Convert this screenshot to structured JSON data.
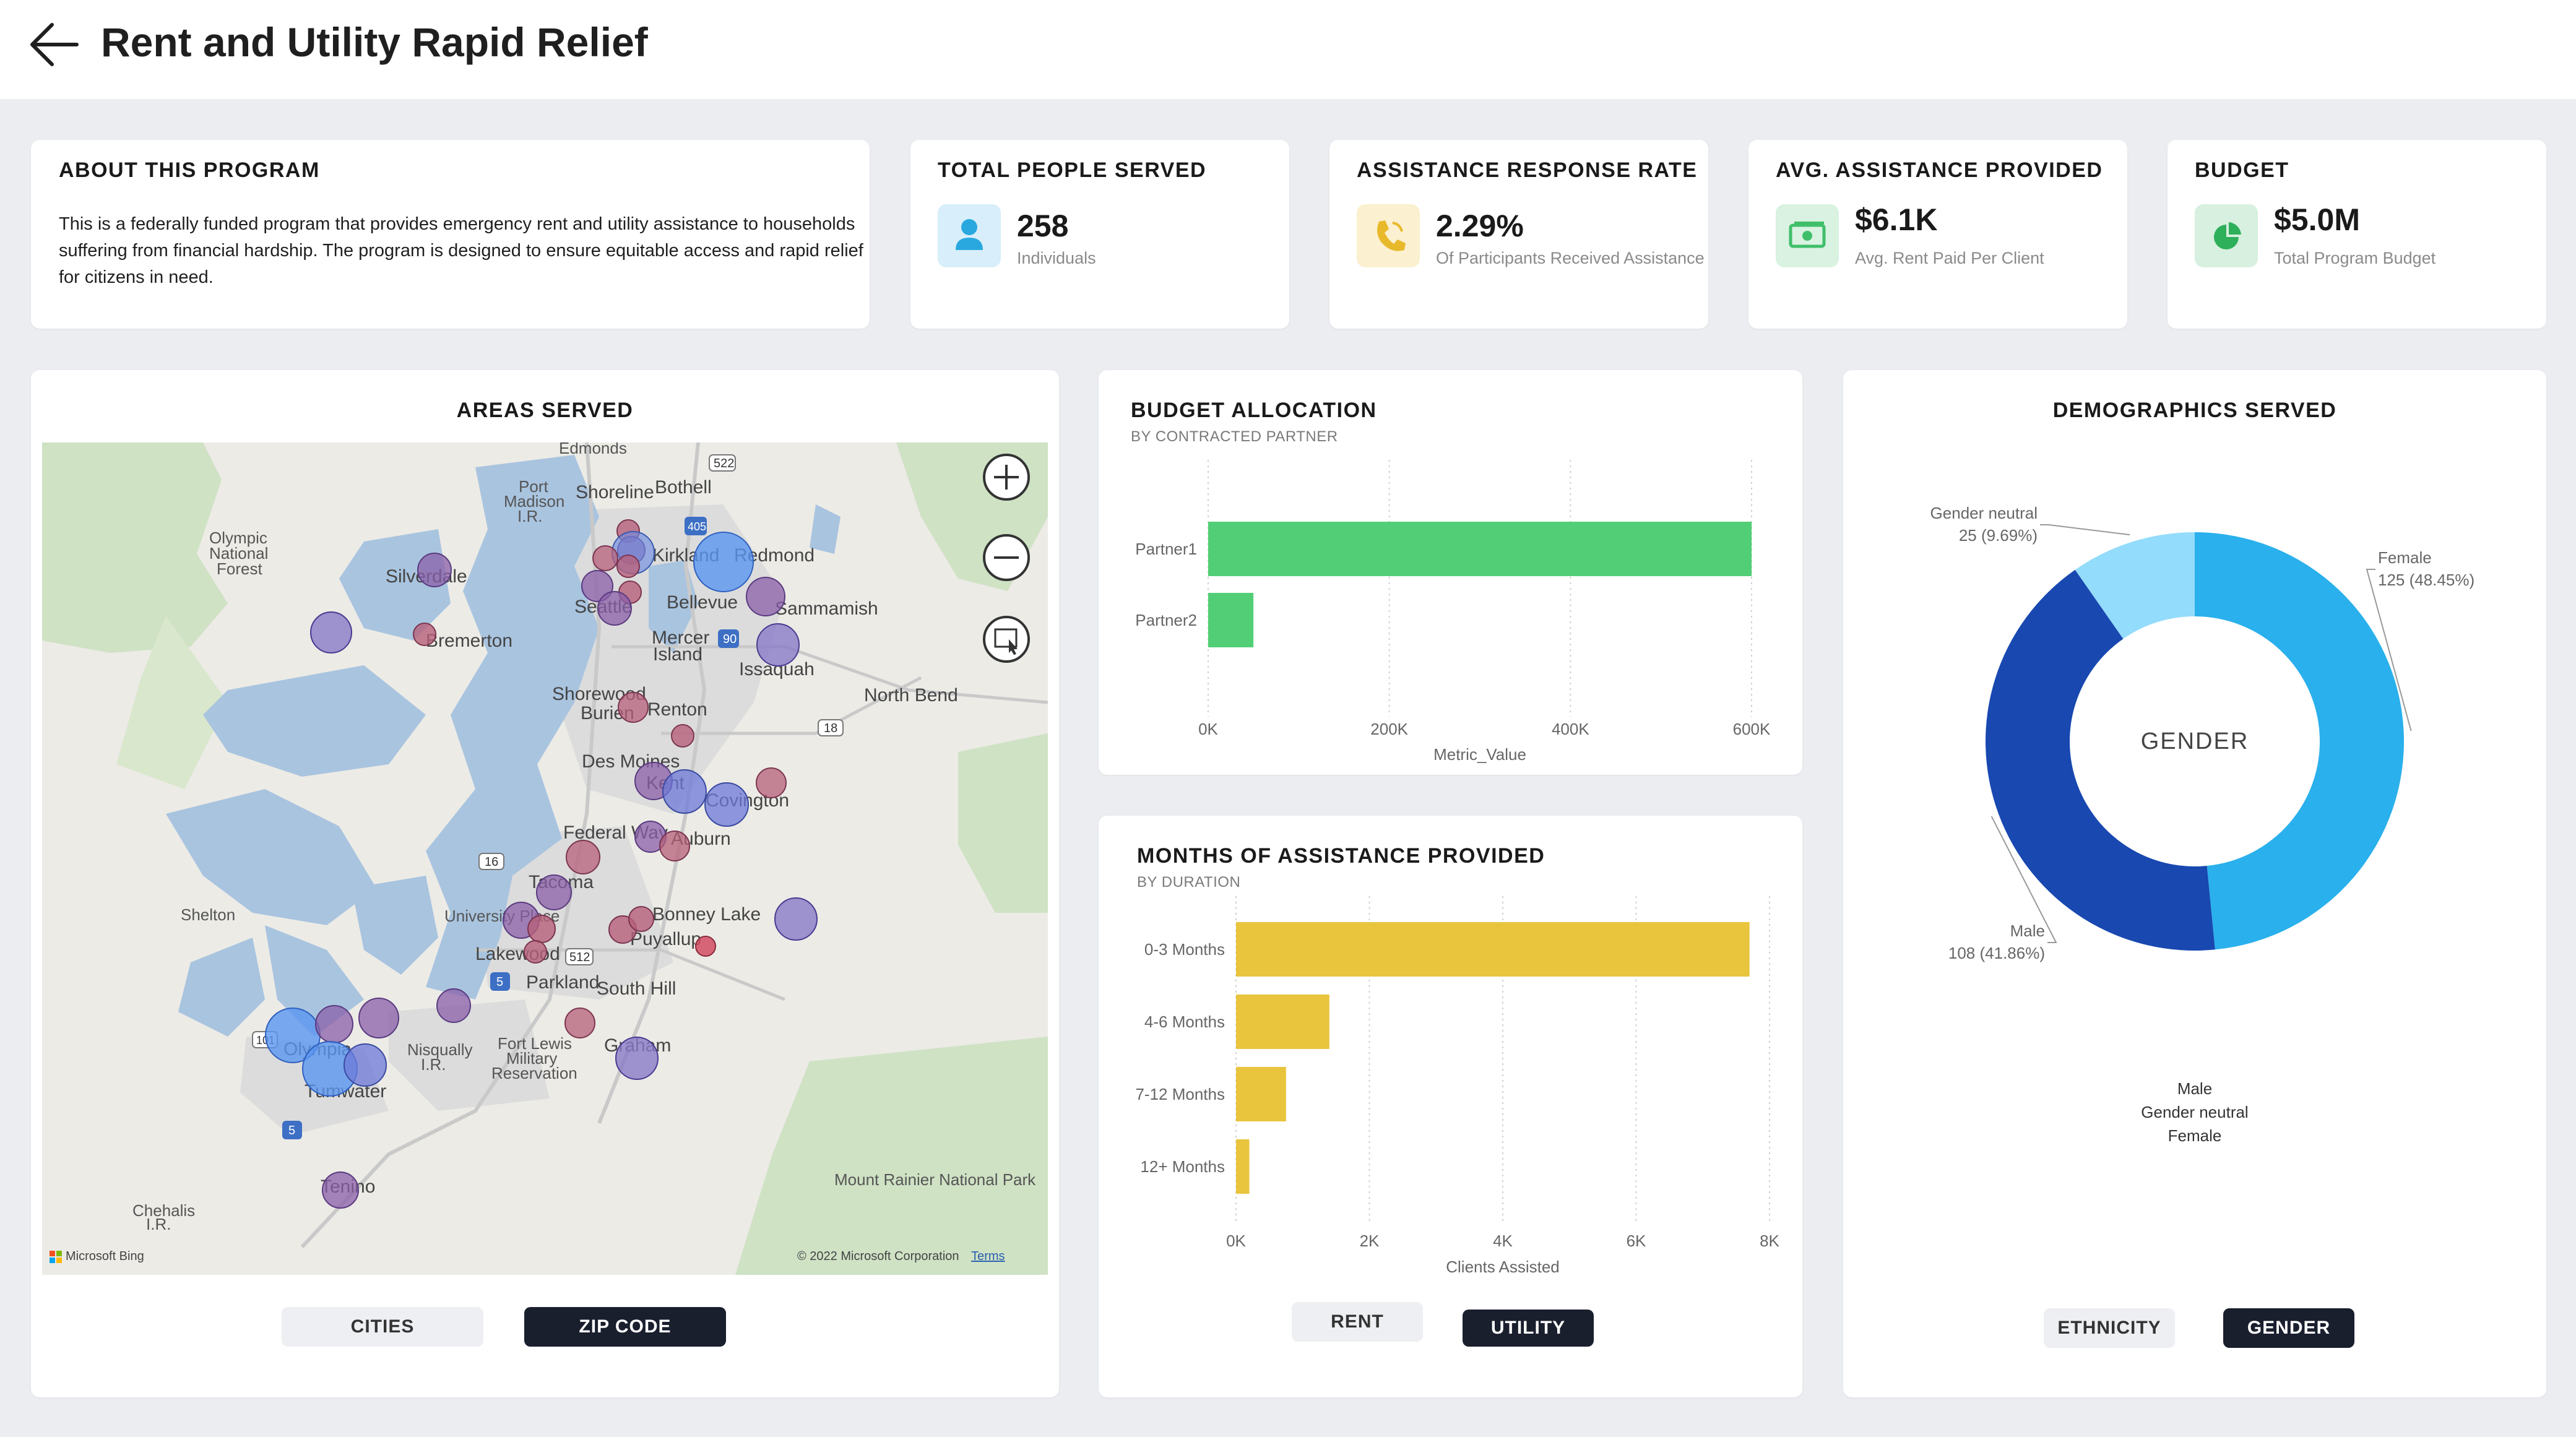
{
  "header": {
    "back_icon": "arrow-left-icon",
    "title": "Rent and Utility Rapid Relief"
  },
  "about": {
    "title": "ABOUT THIS PROGRAM",
    "text": "This is a federally funded program that provides emergency rent and utility assistance to households suffering from financial hardship. The program is designed to ensure equitable access and rapid relief for citizens in need."
  },
  "kpis": [
    {
      "title": "TOTAL PEOPLE SERVED",
      "value": "258",
      "caption": "Individuals",
      "icon": "person-icon",
      "color": "#29a8e0",
      "bg": "#d8eefa"
    },
    {
      "title": "ASSISTANCE RESPONSE RATE",
      "value": "2.29%",
      "caption": "Of Participants Received Assistance",
      "icon": "phone-icon",
      "color": "#e8b92a",
      "bg": "#fbf0cf"
    },
    {
      "title": "AVG. ASSISTANCE PROVIDED",
      "value": "$6.1K",
      "caption": "Avg. Rent Paid Per Client",
      "icon": "money-icon",
      "color": "#3fbf6a",
      "bg": "#d9f2e1"
    },
    {
      "title": "BUDGET",
      "value": "$5.0M",
      "caption": "Total Program Budget",
      "icon": "pie-chart-icon",
      "color": "#2eaf5a",
      "bg": "#d7f0df"
    }
  ],
  "areas": {
    "title": "AREAS SERVED",
    "zoom_in_icon": "zoom-in-icon",
    "zoom_out_icon": "zoom-out-icon",
    "select_icon": "select-area-icon",
    "attribution": "Microsoft Bing",
    "copyright": "© 2022 Microsoft Corporation",
    "terms": "Terms",
    "places": [
      "Edmonds",
      "Port Madison I.R.",
      "Shoreline",
      "Bothell",
      "Olympic National Forest",
      "Kirkland",
      "Redmond",
      "Silverdale",
      "Seattle",
      "Bellevue",
      "Sammamish",
      "Bremerton",
      "Mercer Island",
      "Issaquah",
      "North Bend",
      "Shorewood",
      "Burien",
      "Renton",
      "Des Moines",
      "Kent",
      "Covington",
      "Federal Way",
      "Auburn",
      "Shelton",
      "Tacoma",
      "University Place",
      "Bonney Lake",
      "Lakewood",
      "Puyallup",
      "Parkland",
      "South Hill",
      "Olympia",
      "Tumwater",
      "Nisqually I.R.",
      "Fort Lewis Military Reservation",
      "Graham",
      "Tenino",
      "Chehalis I.R.",
      "Mount Rainier National Park"
    ],
    "roads": [
      "522",
      "405",
      "90",
      "18",
      "16",
      "512",
      "5",
      "101"
    ],
    "buttons": {
      "cities": "CITIES",
      "zip": "ZIP CODE"
    }
  },
  "budget": {
    "title": "BUDGET ALLOCATION",
    "subtitle": "BY CONTRACTED PARTNER",
    "chart_data": {
      "type": "bar",
      "orientation": "horizontal",
      "categories": [
        "Partner1",
        "Partner2"
      ],
      "values": [
        600000,
        50000
      ],
      "xlabel": "Metric_Value",
      "xlim": [
        0,
        600000
      ],
      "xticks": [
        "0K",
        "200K",
        "400K",
        "600K"
      ],
      "color": "#52cf76"
    }
  },
  "months": {
    "title": "MONTHS OF ASSISTANCE PROVIDED",
    "subtitle": "BY DURATION",
    "chart_data": {
      "type": "bar",
      "orientation": "horizontal",
      "categories": [
        "0-3 Months",
        "4-6 Months",
        "7-12 Months",
        "12+ Months"
      ],
      "values": [
        7700,
        1400,
        750,
        200
      ],
      "xlabel": "Clients Assisted",
      "xlim": [
        0,
        8000
      ],
      "xticks": [
        "0K",
        "2K",
        "4K",
        "6K",
        "8K"
      ],
      "color": "#e9c43d"
    },
    "buttons": {
      "rent": "RENT",
      "utility": "UTILITY"
    }
  },
  "demographics": {
    "title": "DEMOGRAPHICS SERVED",
    "center_label": "GENDER",
    "chart_data": {
      "type": "pie",
      "donut": true,
      "categories": [
        "Female",
        "Male",
        "Gender neutral"
      ],
      "values": [
        125,
        108,
        25
      ],
      "labels": [
        "125 (48.45%)",
        "108 (41.86%)",
        "25 (9.69%)"
      ],
      "colors": [
        "#2ab0ec",
        "#1848b0",
        "#93dcfb"
      ],
      "legend": [
        "Male",
        "Gender neutral",
        "Female"
      ]
    },
    "buttons": {
      "ethnicity": "ETHNICITY",
      "gender": "GENDER"
    }
  }
}
